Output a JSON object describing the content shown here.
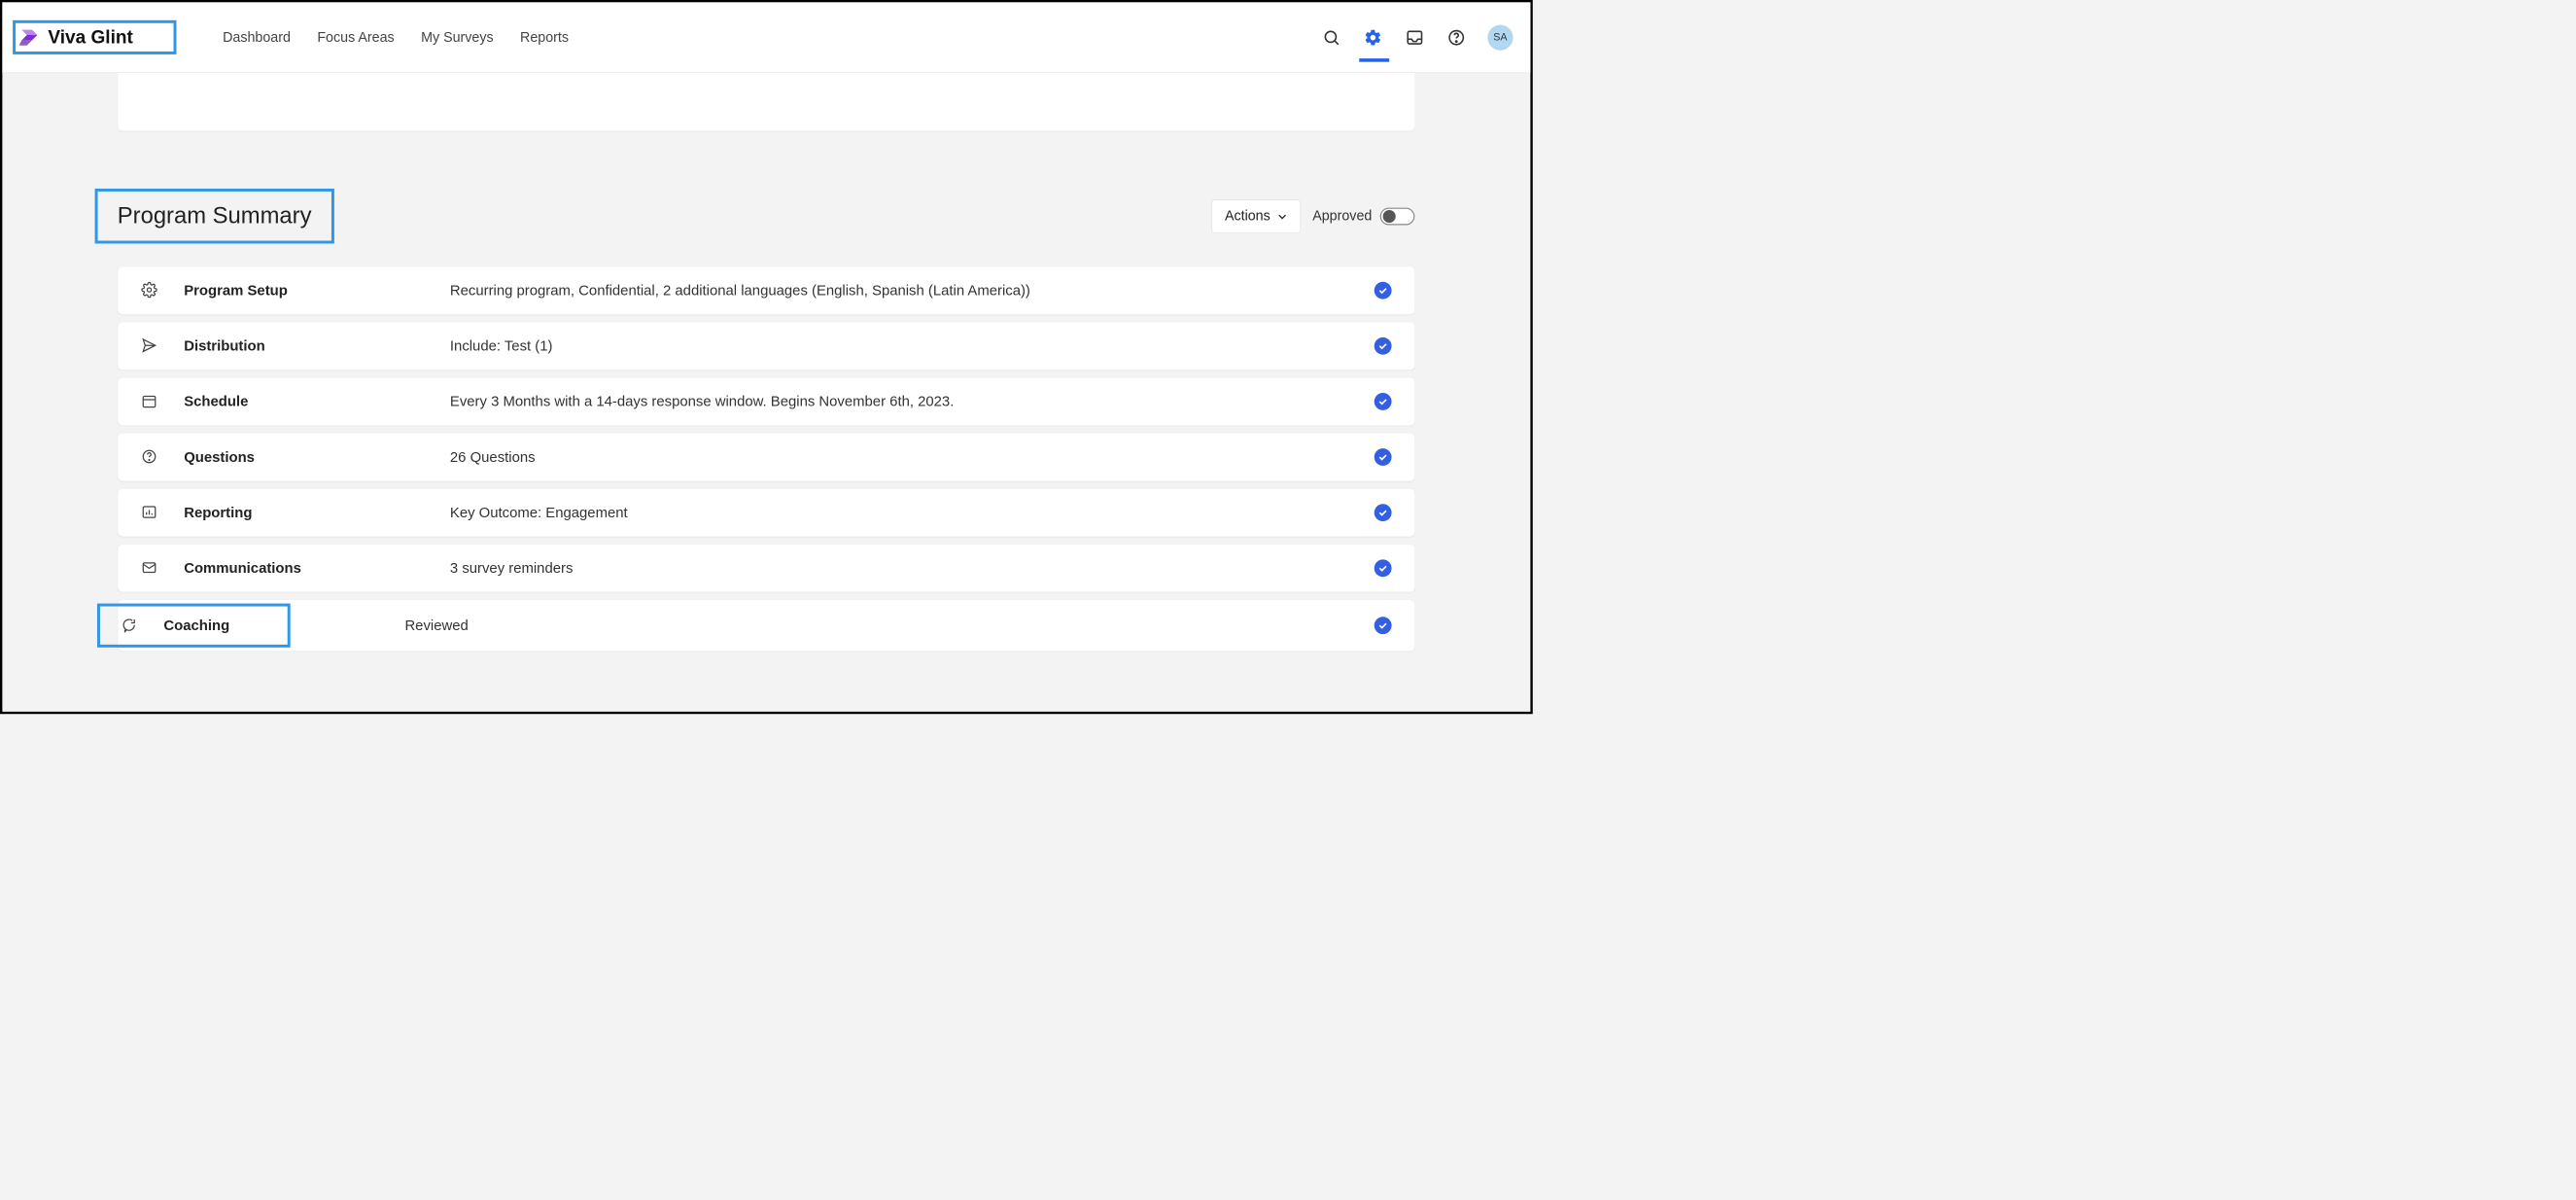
{
  "brand": {
    "name": "Viva Glint"
  },
  "nav": {
    "items": [
      "Dashboard",
      "Focus Areas",
      "My Surveys",
      "Reports"
    ]
  },
  "avatar": {
    "initials": "SA"
  },
  "section": {
    "title": "Program Summary"
  },
  "actions": {
    "label": "Actions"
  },
  "approved": {
    "label": "Approved"
  },
  "rows": [
    {
      "label": "Program Setup",
      "desc": "Recurring program, Confidential, 2 additional languages (English, Spanish (Latin America))"
    },
    {
      "label": "Distribution",
      "desc": "Include: Test (1)"
    },
    {
      "label": "Schedule",
      "desc": "Every 3 Months with a 14-days response window. Begins November 6th, 2023."
    },
    {
      "label": "Questions",
      "desc": "26 Questions"
    },
    {
      "label": "Reporting",
      "desc": "Key Outcome: Engagement"
    },
    {
      "label": "Communications",
      "desc": "3 survey reminders"
    },
    {
      "label": "Coaching",
      "desc": "Reviewed"
    }
  ]
}
